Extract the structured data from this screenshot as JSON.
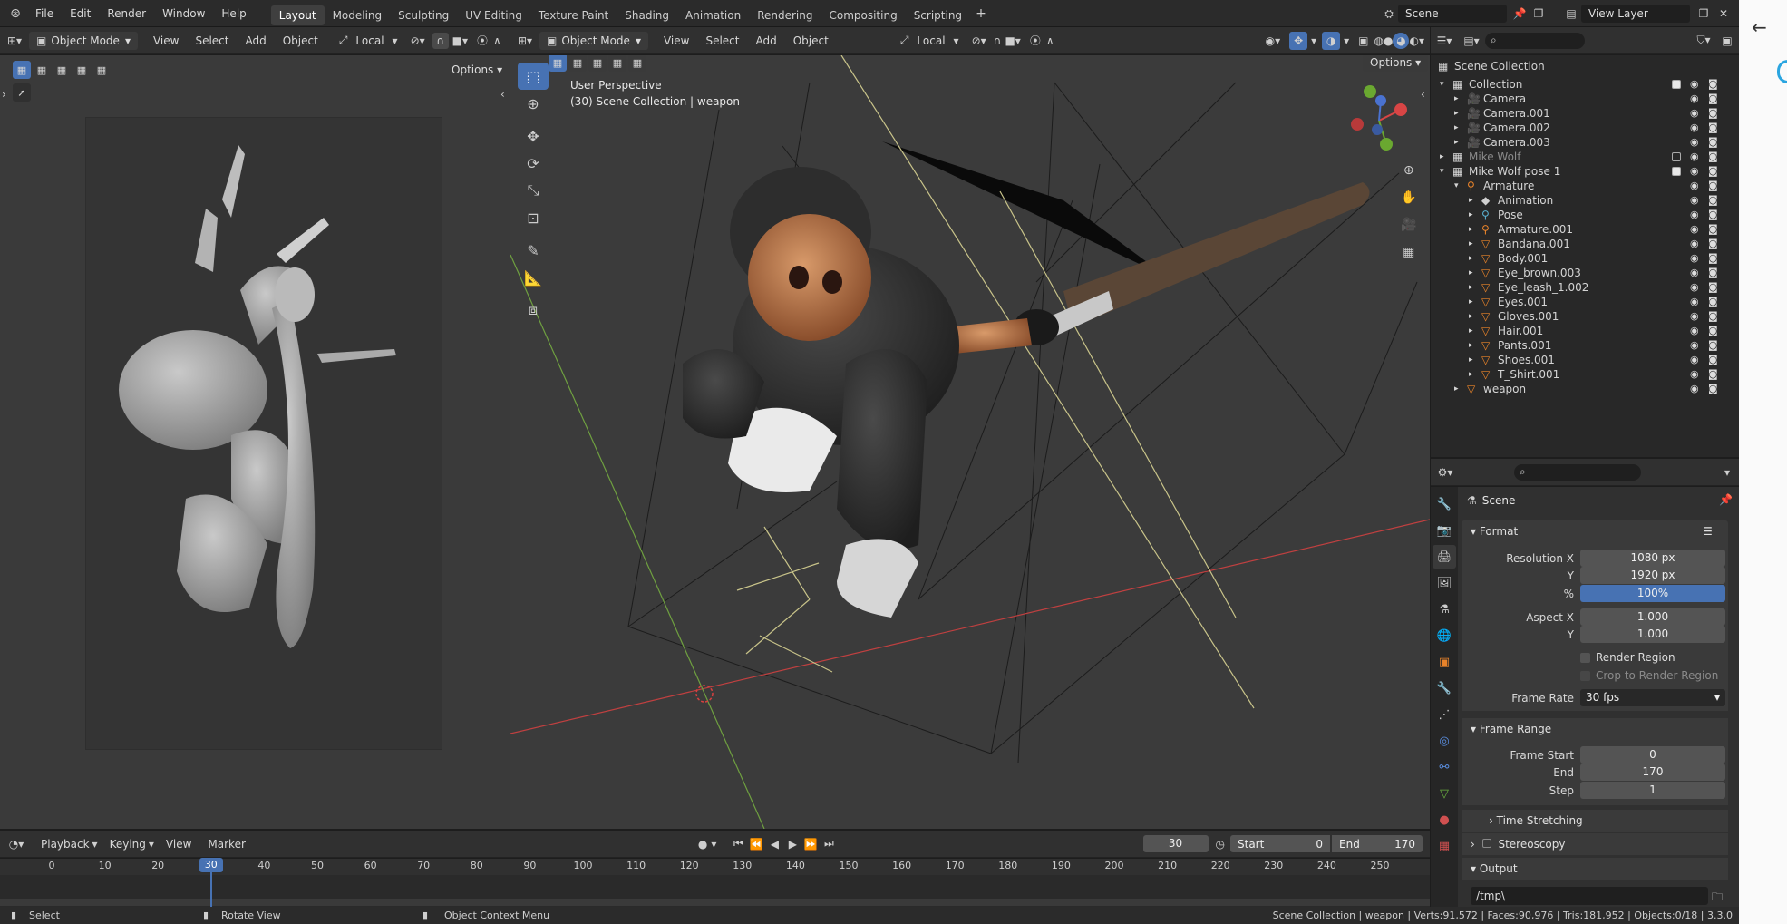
{
  "colors": {
    "accent": "#4772b3",
    "orange": "#e8832a",
    "bg": "#393939",
    "header": "#303030"
  },
  "topmenu": {
    "items": [
      "File",
      "Edit",
      "Render",
      "Window",
      "Help"
    ]
  },
  "workspaces": [
    "Layout",
    "Modeling",
    "Sculpting",
    "UV Editing",
    "Texture Paint",
    "Shading",
    "Animation",
    "Rendering",
    "Compositing",
    "Scripting"
  ],
  "scene": {
    "label": "Scene",
    "view_layer": "View Layer"
  },
  "image_editor": {
    "mode": "Object Mode",
    "menus": [
      "View",
      "Select",
      "Add",
      "Object"
    ],
    "orientation": "Local",
    "options": "Options"
  },
  "viewport": {
    "mode": "Object Mode",
    "menus": [
      "View",
      "Select",
      "Add",
      "Object"
    ],
    "orientation": "Local",
    "options": "Options",
    "perspective": "User Perspective",
    "collection_info": "(30) Scene Collection | weapon"
  },
  "outliner": {
    "root": "Scene Collection",
    "rows": [
      {
        "name": "Collection",
        "indent": 1,
        "icon": "collection"
      },
      {
        "name": "Camera",
        "indent": 2,
        "icon": "camera"
      },
      {
        "name": "Camera.001",
        "indent": 2,
        "icon": "camera"
      },
      {
        "name": "Camera.002",
        "indent": 2,
        "icon": "camera"
      },
      {
        "name": "Camera.003",
        "indent": 2,
        "icon": "camera"
      },
      {
        "name": "Mike Wolf",
        "indent": 1,
        "icon": "collection"
      },
      {
        "name": "Mike Wolf pose 1",
        "indent": 1,
        "icon": "collection"
      },
      {
        "name": "Armature",
        "indent": 2,
        "icon": "armature"
      },
      {
        "name": "Animation",
        "indent": 3,
        "icon": "action"
      },
      {
        "name": "Pose",
        "indent": 3,
        "icon": "pose"
      },
      {
        "name": "Armature.001",
        "indent": 3,
        "icon": "armature"
      },
      {
        "name": "Bandana.001",
        "indent": 3,
        "icon": "mesh"
      },
      {
        "name": "Body.001",
        "indent": 3,
        "icon": "mesh"
      },
      {
        "name": "Eye_brown.003",
        "indent": 3,
        "icon": "mesh"
      },
      {
        "name": "Eye_leash_1.002",
        "indent": 3,
        "icon": "mesh"
      },
      {
        "name": "Eyes.001",
        "indent": 3,
        "icon": "mesh"
      },
      {
        "name": "Gloves.001",
        "indent": 3,
        "icon": "mesh"
      },
      {
        "name": "Hair.001",
        "indent": 3,
        "icon": "mesh"
      },
      {
        "name": "Pants.001",
        "indent": 3,
        "icon": "mesh"
      },
      {
        "name": "Shoes.001",
        "indent": 3,
        "icon": "mesh"
      },
      {
        "name": "T_Shirt.001",
        "indent": 3,
        "icon": "mesh"
      },
      {
        "name": "weapon",
        "indent": 2,
        "icon": "mesh"
      }
    ]
  },
  "properties": {
    "context": "Scene",
    "format_label": "Format",
    "resolution_x_label": "Resolution X",
    "resolution_x": "1080 px",
    "y_label": "Y",
    "resolution_y": "1920 px",
    "percent_label": "%",
    "percent": "100%",
    "aspect_x_label": "Aspect X",
    "aspect_x": "1.000",
    "aspect_y_label": "Y",
    "aspect_y": "1.000",
    "render_region": "Render Region",
    "crop_region": "Crop to Render Region",
    "frame_rate_label": "Frame Rate",
    "frame_rate": "30 fps",
    "frame_range_label": "Frame Range",
    "frame_start_label": "Frame Start",
    "frame_start": "0",
    "end_label": "End",
    "frame_end": "170",
    "step_label": "Step",
    "step": "1",
    "time_stretching": "Time Stretching",
    "stereoscopy": "Stereoscopy",
    "output": "Output",
    "output_path": "/tmp\\"
  },
  "timeline": {
    "menus": [
      "Playback",
      "Keying",
      "View",
      "Marker"
    ],
    "current_frame": "30",
    "start_label": "Start",
    "start": "0",
    "end_label": "End",
    "end": "170",
    "ticks": [
      "0",
      "10",
      "20",
      "30",
      "40",
      "50",
      "60",
      "70",
      "80",
      "90",
      "100",
      "110",
      "120",
      "130",
      "140",
      "150",
      "160",
      "170",
      "180",
      "190",
      "200",
      "210",
      "220",
      "230",
      "240",
      "250"
    ],
    "current_tick": "30",
    "playhead_frame": 30
  },
  "statusbar": {
    "select": "Select",
    "rotate": "Rotate View",
    "context_menu": "Object Context Menu",
    "stats": "Scene Collection | weapon | Verts:91,572 | Faces:90,976 | Tris:181,952 | Objects:0/18 | 3.3.0"
  }
}
